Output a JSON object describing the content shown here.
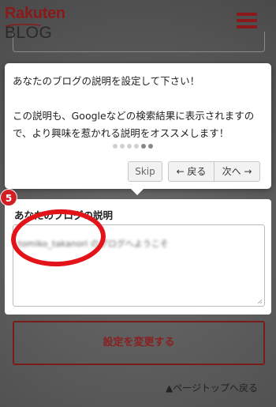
{
  "header": {
    "logo_brand": "Rakuten",
    "logo_product": "BLOG",
    "menu_icon": "hamburger-icon",
    "brand_color": "#8a1a1a"
  },
  "tour": {
    "line1": "あなたのブログの説明を設定して下さい！",
    "line2": "この説明も、Googleなどの検索結果に表示されますので、より興味を惹かれる説明をオススメします！",
    "total_steps": 6,
    "current_step": 5,
    "skip_label": "Skip",
    "prev_label": "← 戻る",
    "next_label": "次へ →",
    "step_badge": "5"
  },
  "form": {
    "section_title": "あなたのブログの説明",
    "description_value": "tomiko_takanori のブログへようこそ",
    "submit_label": "設定を変更する",
    "page_top_label": "▲ページトップへ戻る"
  },
  "colors": {
    "overlay": "#5d5d5d",
    "highlight_circle": "#e2141a",
    "badge": "#d01f25"
  }
}
